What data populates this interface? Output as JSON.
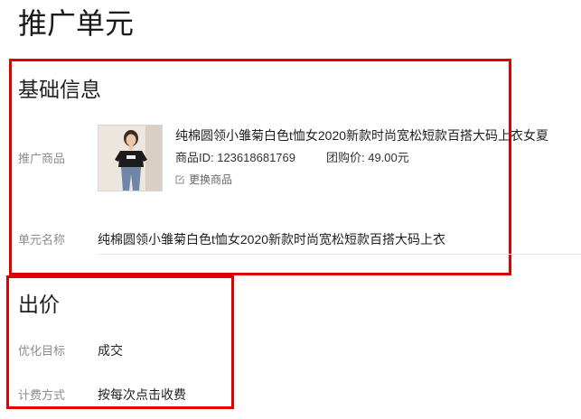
{
  "page": {
    "title": "推广单元"
  },
  "basic": {
    "title": "基础信息",
    "product_label": "推广商品",
    "product": {
      "name": "纯棉圆领小雏菊白色t恤女2020新款时尚宽松短款百搭大码上衣女夏",
      "id_text": "商品ID: 123618681769",
      "group_price_text": "团购价: 49.00元",
      "change_label": "更换商品",
      "change_icon": "edit-icon"
    },
    "unit_name_label": "单元名称",
    "unit_name_value": "纯棉圆领小雏菊白色t恤女2020新款时尚宽松短款百搭大码上衣"
  },
  "bid": {
    "title": "出价",
    "goal_label": "优化目标",
    "goal_value": "成交",
    "billing_label": "计费方式",
    "billing_value": "按每次点击收费"
  },
  "colors": {
    "highlight_border": "#e00000",
    "label_gray": "#8c8c8c"
  }
}
